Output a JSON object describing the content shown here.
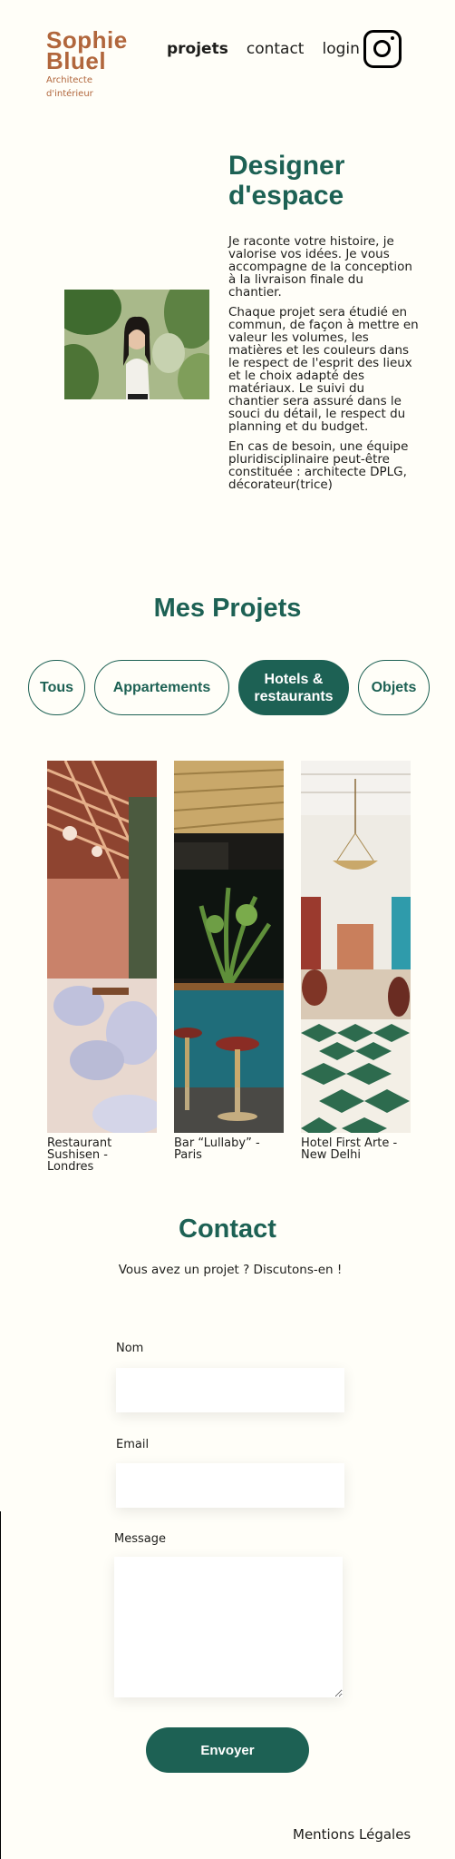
{
  "header": {
    "brand_line1": "Sophie",
    "brand_line2": "Bluel",
    "brand_sub1": "Architecte",
    "brand_sub2": "d'intérieur",
    "nav": [
      {
        "label": "projets",
        "active": true
      },
      {
        "label": "contact",
        "active": false
      },
      {
        "label": "login",
        "active": false
      }
    ],
    "social_icon": "instagram-icon"
  },
  "intro": {
    "title_line1": "Designer",
    "title_line2": "d'espace",
    "paragraphs": [
      "Je raconte votre histoire, je valorise vos idées. Je vous accompagne de la conception à la livraison finale du chantier.",
      "Chaque projet sera étudié en commun, de façon à mettre en valeur les volumes, les matières et les couleurs dans le respect de l'esprit des lieux et le choix adapté des matériaux. Le suivi du chantier sera assuré dans le souci du détail, le respect du planning et du budget.",
      "En cas de besoin, une équipe pluridisciplinaire peut-être constituée : architecte DPLG, décorateur(trice)"
    ]
  },
  "projects": {
    "title": "Mes Projets",
    "filters": [
      {
        "label": "Tous",
        "active": false
      },
      {
        "label": "Appartements",
        "active": false
      },
      {
        "label": "Hotels & restaurants",
        "active": true
      },
      {
        "label": "Objets",
        "active": false
      }
    ],
    "items": [
      {
        "caption": "Restaurant Sushisen - Londres"
      },
      {
        "caption": "Bar “Lullaby” - Paris"
      },
      {
        "caption": "Hotel First Arte - New Delhi"
      }
    ]
  },
  "contact": {
    "title": "Contact",
    "subtitle": "Vous avez un projet ? Discutons-en !",
    "name_label": "Nom",
    "email_label": "Email",
    "message_label": "Message",
    "submit_label": "Envoyer"
  },
  "footer": {
    "legal": "Mentions Légales"
  },
  "colors": {
    "accent": "#1d6154",
    "brand": "#b1663c",
    "background": "#fffef8"
  }
}
